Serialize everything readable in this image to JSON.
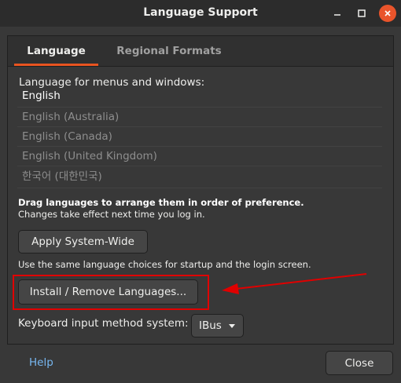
{
  "window": {
    "title": "Language Support",
    "controls": [
      "minimize-icon",
      "maximize-icon",
      "close-icon"
    ],
    "close_color": "#e9542b"
  },
  "tabs": [
    {
      "label": "Language",
      "active": true
    },
    {
      "label": "Regional Formats",
      "active": false
    }
  ],
  "language": {
    "section_label": "Language for menus and windows:",
    "items": [
      "English",
      "English (Australia)",
      "English (Canada)",
      "English (United Kingdom)",
      "한국어 (대한민국)"
    ],
    "hint_bold": "Drag languages to arrange them in order of preference.",
    "hint": "Changes take effect next time you log in.",
    "apply_label": "Apply System-Wide",
    "note": "Use the same language choices for startup and the login screen.",
    "install_label": "Install / Remove Languages...",
    "keyboard_label": "Keyboard input method system:",
    "keyboard_value": "IBus"
  },
  "footer": {
    "help_label": "Help",
    "close_label": "Close"
  },
  "colors": {
    "accent": "#e95420",
    "annotation": "#e00000",
    "link": "#77b7f0"
  }
}
